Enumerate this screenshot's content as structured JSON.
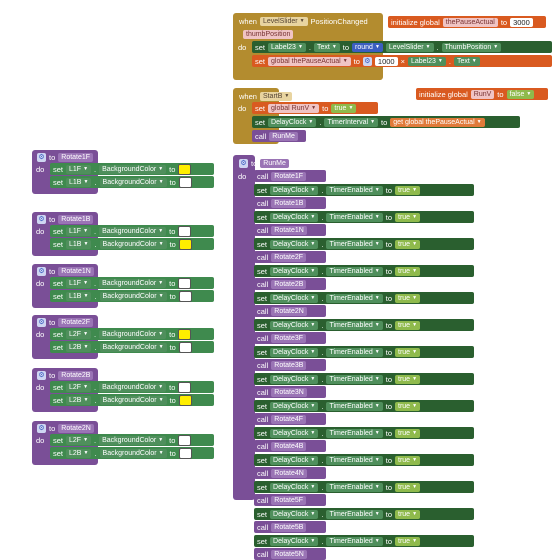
{
  "kw": {
    "when": "when",
    "do": "do",
    "set": "set",
    "to": "to",
    "call": "call",
    "initialize_global": "initialize global",
    "dot": ".",
    "times": "×"
  },
  "event_slider": {
    "component": "LevelSlider",
    "event": "PositionChanged",
    "param": "thumbPosition",
    "label": "Label23",
    "prop_text": "Text",
    "round": "round",
    "thumb": "ThumbPosition",
    "global_var": "global thePauseActual",
    "number": "1000"
  },
  "init_pause": {
    "name": "thePauseActual",
    "value": "3000"
  },
  "init_runv": {
    "name": "RunV",
    "value": "false"
  },
  "event_start": {
    "component": "StartB",
    "event": "Click",
    "global_runv": "global RunV",
    "true_val": "true",
    "clock": "DelayClock",
    "prop": "TimerInterval",
    "get": "get",
    "global_pause": "global thePauseActual",
    "call_target": "RunMe"
  },
  "runme": {
    "name": "RunMe",
    "clock": "DelayClock",
    "prop": "TimerEnabled",
    "true_val": "true",
    "steps": [
      "Rotate1F",
      "Rotate1B",
      "Rotate1N",
      "Rotate2F",
      "Rotate2B",
      "Rotate2N",
      "Rotate3F",
      "Rotate3B",
      "Rotate3N",
      "Rotate4F",
      "Rotate4B",
      "Rotate4N",
      "Rotate5F",
      "Rotate5B",
      "Rotate5N"
    ]
  },
  "procedures": [
    {
      "name": "Rotate1F",
      "rows": [
        {
          "comp": "L1F",
          "color": "#ffee00"
        },
        {
          "comp": "L1B",
          "color": "#ffffff"
        }
      ]
    },
    {
      "name": "Rotate1B",
      "rows": [
        {
          "comp": "L1F",
          "color": "#ffffff"
        },
        {
          "comp": "L1B",
          "color": "#ffee00"
        }
      ]
    },
    {
      "name": "Rotate1N",
      "rows": [
        {
          "comp": "L1F",
          "color": "#ffffff"
        },
        {
          "comp": "L1B",
          "color": "#ffffff"
        }
      ]
    },
    {
      "name": "Rotate2F",
      "rows": [
        {
          "comp": "L2F",
          "color": "#ffee00"
        },
        {
          "comp": "L2B",
          "color": "#ffffff"
        }
      ]
    },
    {
      "name": "Rotate2B",
      "rows": [
        {
          "comp": "L2F",
          "color": "#ffffff"
        },
        {
          "comp": "L2B",
          "color": "#ffee00"
        }
      ]
    },
    {
      "name": "Rotate2N",
      "rows": [
        {
          "comp": "L2F",
          "color": "#ffffff"
        },
        {
          "comp": "L2B",
          "color": "#ffffff"
        }
      ]
    }
  ],
  "prop_bg": "BackgroundColor"
}
